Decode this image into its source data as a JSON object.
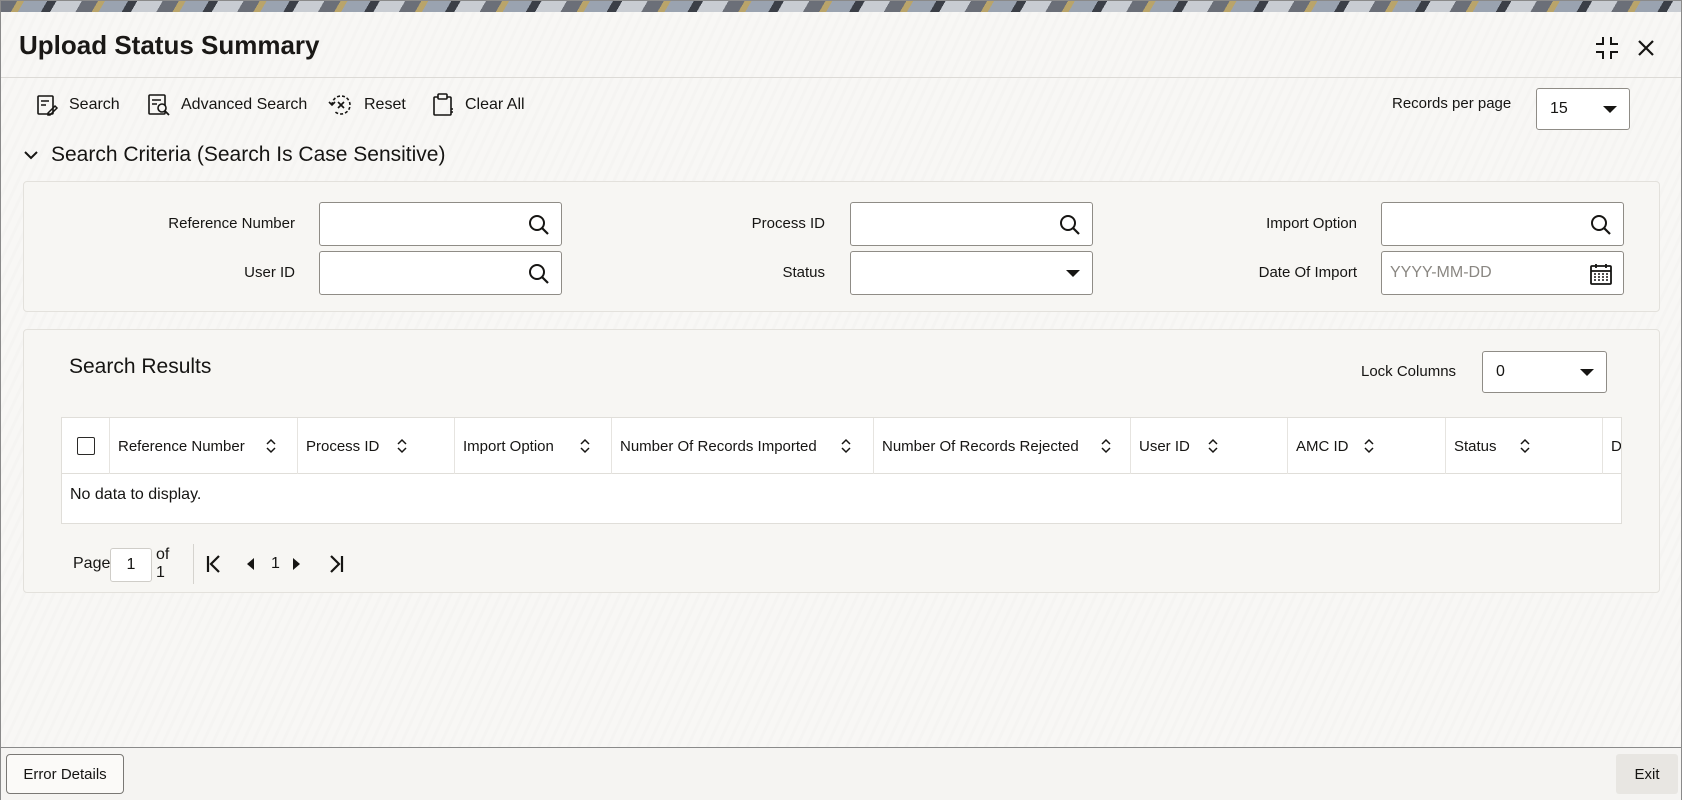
{
  "window": {
    "title": "Upload Status Summary"
  },
  "toolbar": {
    "search_label": "Search",
    "advanced_search_label": "Advanced Search",
    "reset_label": "Reset",
    "clear_all_label": "Clear All",
    "records_per_page_label": "Records per page",
    "records_per_page_value": "15"
  },
  "criteria": {
    "heading": "Search Criteria (Search Is Case Sensitive)",
    "reference_number_label": "Reference Number",
    "process_id_label": "Process ID",
    "import_option_label": "Import Option",
    "user_id_label": "User ID",
    "status_label": "Status",
    "date_of_import_label": "Date Of Import",
    "date_placeholder": "YYYY-MM-DD"
  },
  "results": {
    "heading": "Search Results",
    "lock_columns_label": "Lock Columns",
    "lock_columns_value": "0",
    "columns": [
      "Reference Number",
      "Process ID",
      "Import Option",
      "Number Of Records Imported",
      "Number Of Records Rejected",
      "User ID",
      "AMC ID",
      "Status",
      "D"
    ],
    "empty_message": "No data to display."
  },
  "pager": {
    "page_label": "Page",
    "current_page": "1",
    "of_label": "of 1",
    "page_number": "1"
  },
  "footer": {
    "error_details_label": "Error Details",
    "exit_label": "Exit"
  },
  "icons": {
    "maximize": "maximize-icon",
    "close": "close-icon",
    "search": "search-icon",
    "calendar": "calendar-icon",
    "sort": "sort-icon"
  }
}
